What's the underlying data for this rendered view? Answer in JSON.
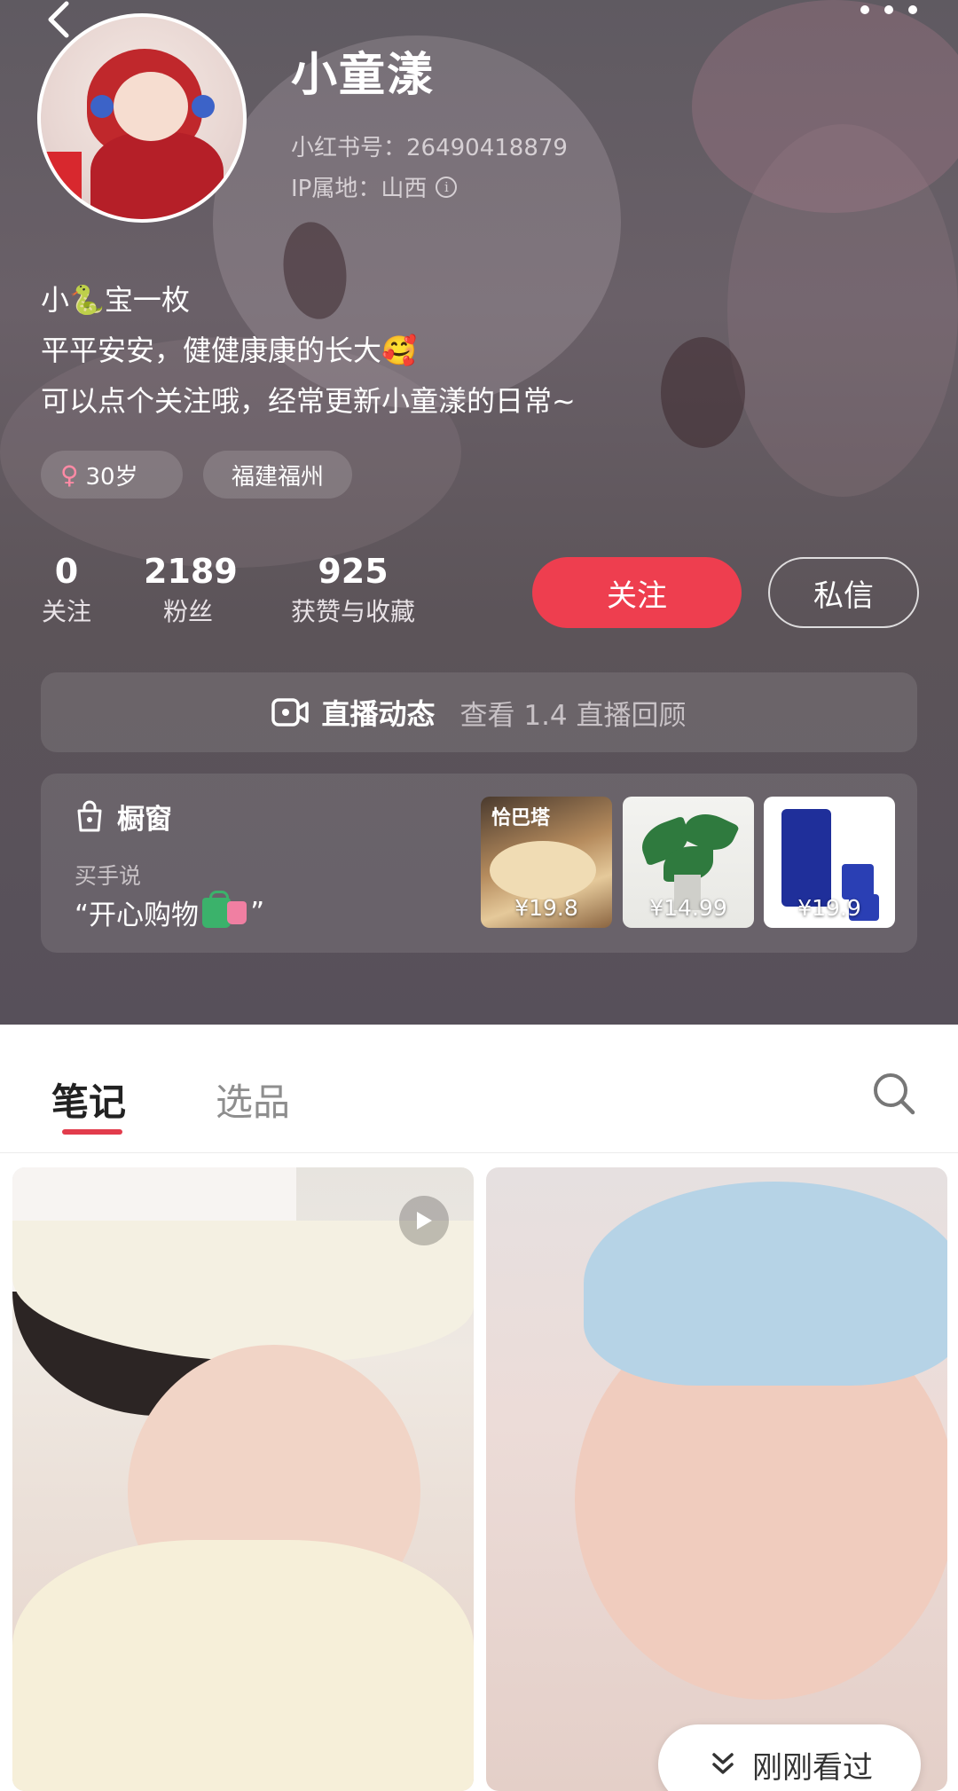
{
  "profile": {
    "name": "小童漾",
    "id_text": "小红书号：26490418879",
    "ip_text": "IP属地：山西",
    "bio": [
      "小🐍宝一枚",
      "平平安安，健健康康的长大🥰",
      "可以点个关注哦，经常更新小童漾的日常~"
    ],
    "tags": {
      "gender_age": "30岁",
      "location": "福建福州"
    },
    "stats": [
      {
        "value": "0",
        "label": "关注"
      },
      {
        "value": "2189",
        "label": "粉丝"
      },
      {
        "value": "925",
        "label": "获赞与收藏"
      }
    ],
    "follow_label": "关注",
    "message_label": "私信"
  },
  "live": {
    "title": "直播动态",
    "subtitle": "查看 1.4 直播回顾"
  },
  "shop": {
    "title": "橱窗",
    "subtitle": "买手说",
    "quote_open": "“开心购物",
    "quote_close": "”",
    "products": [
      {
        "brand": "恰巴塔",
        "price": "¥19.8"
      },
      {
        "price": "¥14.99"
      },
      {
        "price": "¥19.9"
      }
    ]
  },
  "tabs": [
    {
      "label": "笔记",
      "active": true
    },
    {
      "label": "选品",
      "active": false
    }
  ],
  "feed": {
    "recent_label": "刚刚看过"
  },
  "colors": {
    "accent": "#ee3e4f",
    "header_bg": "#5f5a61",
    "tab_indicator": "#e23c4c"
  }
}
